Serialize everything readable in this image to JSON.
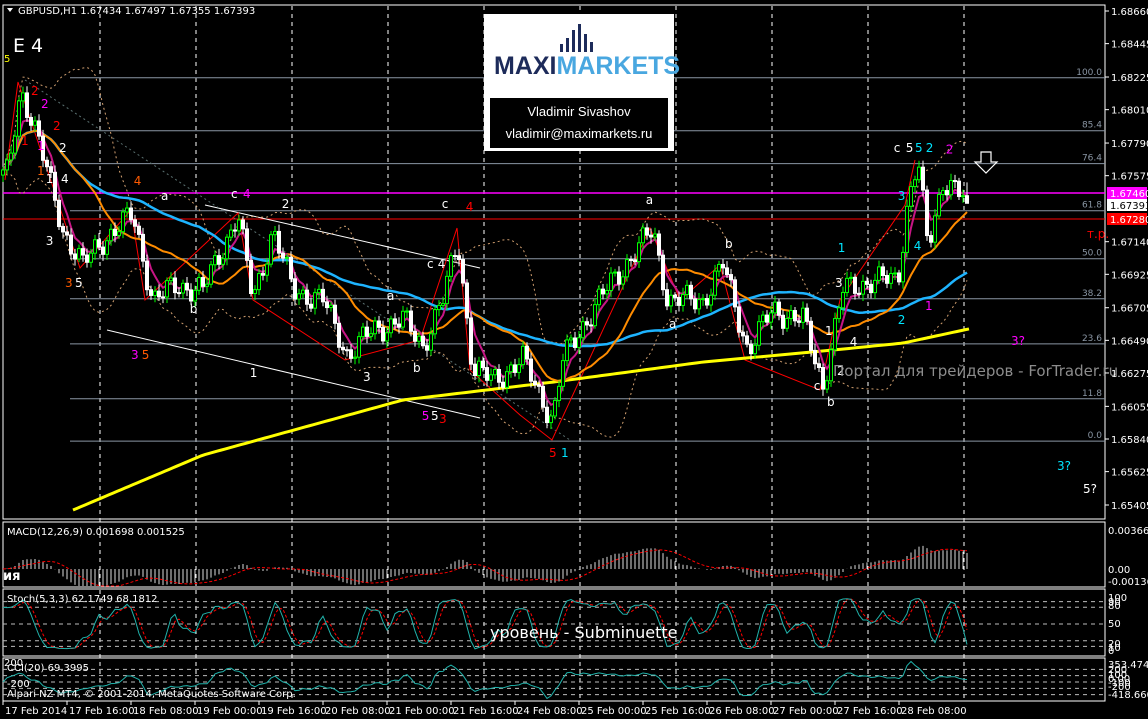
{
  "header": {
    "symbol_line": "GBPUSD,H1  1.67434 1.67497 1.67355 1.67393",
    "wave_title": "E 4",
    "corner_mark": "5"
  },
  "logo": {
    "brand_dark": "MAXI",
    "brand_light": "MARKETS",
    "author": "Vladimir Sivashov",
    "email": "vladimir@maximarkets.ru"
  },
  "watermark": "Портал для трейдеров - ForTrader.ru",
  "overlay_ru": "ия",
  "overlay_level": "уровень - Subminuette",
  "footer": "Alpari NZ MT4, © 2001-2014, MetaQuotes Software Corp.",
  "colors": {
    "bull": "#00ff00",
    "bear": "#ffffff",
    "ma_fast": "#c71585",
    "ma_mid": "#ff8c00",
    "ma_slow": "#1eb4ff",
    "ma_long": "#ffff00",
    "magenta_line": "#ff00ff",
    "red_line": "#ff0000",
    "grid": "#8a96a4"
  },
  "chart_data": {
    "type": "candlestick",
    "title": "GBPUSD,H1",
    "ylim": [
      1.653,
      1.687
    ],
    "price_ticks": [
      "1.68660",
      "1.68445",
      "1.68225",
      "1.68010",
      "1.67790",
      "1.67575",
      "1.67140",
      "1.66925",
      "1.66705",
      "1.66490",
      "1.66275",
      "1.66055",
      "1.65840",
      "1.65625",
      "1.65405"
    ],
    "time_labels": [
      "17 Feb 2014",
      "17 Feb 16:00",
      "18 Feb 08:00",
      "19 Feb 00:00",
      "19 Feb 16:00",
      "20 Feb 08:00",
      "21 Feb 00:00",
      "21 Feb 16:00",
      "24 Feb 08:00",
      "25 Feb 00:00",
      "25 Feb 16:00",
      "26 Feb 08:00",
      "27 Feb 00:00",
      "27 Feb 16:00",
      "28 Feb 08:00"
    ],
    "bars_per_label": 16,
    "close_path": [
      [
        1.25,
        1.67579
      ],
      [
        4.5,
        1.68139
      ],
      [
        7.5,
        1.67942
      ],
      [
        11.25,
        1.67579
      ],
      [
        15,
        1.67217
      ],
      [
        20,
        1.66986
      ],
      [
        25,
        1.67151
      ],
      [
        32.5,
        1.67316
      ],
      [
        37.5,
        1.66755
      ],
      [
        43.75,
        1.66854
      ],
      [
        50,
        1.66821
      ],
      [
        58.75,
        1.67316
      ],
      [
        62.5,
        1.66755
      ],
      [
        67.5,
        1.67217
      ],
      [
        72.5,
        1.66821
      ],
      [
        80,
        1.66755
      ],
      [
        86.25,
        1.66393
      ],
      [
        92.5,
        1.66558
      ],
      [
        100,
        1.66624
      ],
      [
        105,
        1.66459
      ],
      [
        110,
        1.66755
      ],
      [
        113.75,
        1.67151
      ],
      [
        117.5,
        1.66294
      ],
      [
        122.5,
        1.66228
      ],
      [
        130,
        1.6636
      ],
      [
        137.5,
        1.65965
      ],
      [
        140,
        1.6636
      ],
      [
        145,
        1.66591
      ],
      [
        152.5,
        1.66887
      ],
      [
        162.5,
        1.67217
      ],
      [
        166.25,
        1.66755
      ],
      [
        175,
        1.66755
      ],
      [
        180,
        1.66986
      ],
      [
        186.25,
        1.66426
      ],
      [
        192.5,
        1.6669
      ],
      [
        200,
        1.66624
      ],
      [
        205,
        1.66195
      ],
      [
        210,
        1.66821
      ],
      [
        217.5,
        1.66887
      ],
      [
        223.75,
        1.66887
      ],
      [
        226.25,
        1.67414
      ],
      [
        228.75,
        1.67678
      ],
      [
        231.25,
        1.67085
      ],
      [
        235,
        1.67546
      ],
      [
        237.5,
        1.67513
      ],
      [
        241,
        1.67393
      ]
    ],
    "long_ma_path": [
      [
        17.5,
        1.65372
      ],
      [
        50,
        1.65734
      ],
      [
        100,
        1.66097
      ],
      [
        137.5,
        1.66215
      ],
      [
        175,
        1.66347
      ],
      [
        207.5,
        1.66426
      ],
      [
        225,
        1.66472
      ],
      [
        242.5,
        1.66571
      ]
    ],
    "fib_levels": [
      {
        "label": "100.0",
        "price": 1.6822
      },
      {
        "label": "85.4",
        "price": 1.67871
      },
      {
        "label": "76.4",
        "price": 1.67654
      },
      {
        "label": "61.8",
        "price": 1.67344
      },
      {
        "label": "50.0",
        "price": 1.67028
      },
      {
        "label": "38.2",
        "price": 1.66764
      },
      {
        "label": "23.6",
        "price": 1.66467
      },
      {
        "label": "11.8",
        "price": 1.66105
      },
      {
        "label": "0.0",
        "price": 1.65826
      }
    ],
    "price_markers": [
      {
        "label": "1.67460",
        "price": 1.6746,
        "color": "#ff00ff"
      },
      {
        "label": "1.67393",
        "price": 1.67393,
        "color": "#ffffff"
      },
      {
        "label": "1.67280",
        "price": 1.6728,
        "color": "#ff0000"
      }
    ],
    "wave_labels": [
      {
        "t": "1",
        "c": "#ff0000",
        "bar": 4.5,
        "p": 1.67777
      },
      {
        "t": "2",
        "c": "#ff0000",
        "bar": 7,
        "p": 1.68106
      },
      {
        "t": "2",
        "c": "#ff00ff",
        "bar": 9.5,
        "p": 1.68021
      },
      {
        "t": "2",
        "c": "#ff0000",
        "bar": 12.5,
        "p": 1.67876
      },
      {
        "t": "1",
        "c": "#ff00ff",
        "bar": 8.5,
        "p": 1.67744
      },
      {
        "t": "2",
        "c": "#ffffff",
        "bar": 14,
        "p": 1.67731
      },
      {
        "t": "1",
        "c": "#ff5a00",
        "bar": 8.5,
        "p": 1.67579
      },
      {
        "t": "1",
        "c": "#ffffff",
        "bar": 10.7,
        "p": 1.67527
      },
      {
        "t": "4",
        "c": "#ffffff",
        "bar": 14.5,
        "p": 1.67527
      },
      {
        "t": "3",
        "c": "#ffffff",
        "bar": 10.7,
        "p": 1.67118
      },
      {
        "t": "3",
        "c": "#ff5a00",
        "bar": 15.5,
        "p": 1.66841
      },
      {
        "t": "5",
        "c": "#ffffff",
        "bar": 18,
        "p": 1.66841
      },
      {
        "t": "4",
        "c": "#ff5a00",
        "bar": 32.7,
        "p": 1.67513
      },
      {
        "t": "a",
        "c": "#ffffff",
        "bar": 39.5,
        "p": 1.67414
      },
      {
        "t": "3",
        "c": "#ff00ff",
        "bar": 32,
        "p": 1.66367
      },
      {
        "t": "5",
        "c": "#ff5a00",
        "bar": 34.7,
        "p": 1.66367
      },
      {
        "t": "b",
        "c": "#ffffff",
        "bar": 46.7,
        "p": 1.6667
      },
      {
        "t": "c",
        "c": "#ffffff",
        "bar": 57,
        "p": 1.67428
      },
      {
        "t": "4",
        "c": "#ff00ff",
        "bar": 60,
        "p": 1.67428
      },
      {
        "t": "2",
        "c": "#ffffff",
        "bar": 69.7,
        "p": 1.67362
      },
      {
        "t": "1",
        "c": "#ffffff",
        "bar": 61.7,
        "p": 1.66248
      },
      {
        "t": "3",
        "c": "#ffffff",
        "bar": 90,
        "p": 1.66222
      },
      {
        "t": "a",
        "c": "#ffffff",
        "bar": 96,
        "p": 1.66755
      },
      {
        "t": "b",
        "c": "#ffffff",
        "bar": 102.5,
        "p": 1.66281
      },
      {
        "t": "c",
        "c": "#ffffff",
        "bar": 106,
        "p": 1.66966
      },
      {
        "t": "4",
        "c": "#ffffff",
        "bar": 108.7,
        "p": 1.66966
      },
      {
        "t": "c",
        "c": "#ffffff",
        "bar": 109.7,
        "p": 1.67362
      },
      {
        "t": "4",
        "c": "#ff0000",
        "bar": 115.7,
        "p": 1.67342
      },
      {
        "t": "5",
        "c": "#ff00ff",
        "bar": 104.7,
        "p": 1.65965
      },
      {
        "t": "5",
        "c": "#ffffff",
        "bar": 107,
        "p": 1.65965
      },
      {
        "t": "3",
        "c": "#ff0000",
        "bar": 109,
        "p": 1.65945
      },
      {
        "t": "5",
        "c": "#ff0000",
        "bar": 136.5,
        "p": 1.65721
      },
      {
        "t": "1",
        "c": "#00e5ff",
        "bar": 139.5,
        "p": 1.65721
      },
      {
        "t": "a",
        "c": "#ffffff",
        "bar": 160.7,
        "p": 1.67388
      },
      {
        "t": "a",
        "c": "#ffffff",
        "bar": 166.5,
        "p": 1.66571
      },
      {
        "t": "b",
        "c": "#ffffff",
        "bar": 180.5,
        "p": 1.67098
      },
      {
        "t": "c",
        "c": "#ffffff",
        "bar": 202.7,
        "p": 1.66162
      },
      {
        "t": "b",
        "c": "#ffffff",
        "bar": 206,
        "p": 1.66057
      },
      {
        "t": "1",
        "c": "#ffffff",
        "bar": 205.5,
        "p": 1.66525
      },
      {
        "t": "2",
        "c": "#ffffff",
        "bar": 208.5,
        "p": 1.66261
      },
      {
        "t": "4",
        "c": "#ffffff",
        "bar": 211.7,
        "p": 1.66452
      },
      {
        "t": "3",
        "c": "#ffffff",
        "bar": 208,
        "p": 1.66841
      },
      {
        "t": "1",
        "c": "#00e5ff",
        "bar": 208.7,
        "p": 1.67072
      },
      {
        "t": "2",
        "c": "#00e5ff",
        "bar": 223.7,
        "p": 1.66597
      },
      {
        "t": "1",
        "c": "#ff00ff",
        "bar": 230.5,
        "p": 1.6669
      },
      {
        "t": "4",
        "c": "#00e5ff",
        "bar": 227.7,
        "p": 1.67085
      },
      {
        "t": "3",
        "c": "#00e5ff",
        "bar": 223.7,
        "p": 1.67414
      },
      {
        "t": "c",
        "c": "#ffffff",
        "bar": 222.7,
        "p": 1.67731
      },
      {
        "t": "5",
        "c": "#ffffff",
        "bar": 225.7,
        "p": 1.67731
      },
      {
        "t": "5",
        "c": "#00e5ff",
        "bar": 228,
        "p": 1.67731
      },
      {
        "t": "2",
        "c": "#00e5ff",
        "bar": 230.7,
        "p": 1.67731
      },
      {
        "t": "2",
        "c": "#ff00ff",
        "bar": 235.7,
        "p": 1.6772
      },
      {
        "t": "3?",
        "c": "#ff00ff",
        "bar": 252,
        "p": 1.66459
      },
      {
        "t": "3?",
        "c": "#00e5ff",
        "bar": 263.5,
        "p": 1.65635
      },
      {
        "t": "5?",
        "c": "#ffffff",
        "bar": 270,
        "p": 1.65484,
        "big": true
      },
      {
        "t": "т.р.",
        "c": "#ff0000",
        "bar": 271,
        "p": 1.67164
      }
    ],
    "macd": {
      "header": "MACD(12,26,9) 0.001698 0.001525",
      "ticks": [
        "0.003661",
        "0.00",
        "-0.001362"
      ]
    },
    "stoch": {
      "header": "Stoch(5,3,3) 62.1749 68.1812",
      "ticks": [
        "100",
        "90",
        "80",
        "50",
        "20",
        "10",
        "0"
      ],
      "levels": [
        90,
        80,
        50,
        20,
        10
      ]
    },
    "cci": {
      "header": "CCI(20) 69.3995",
      "ticks": [
        "353.4747",
        "200",
        "100",
        "0.00",
        "-100",
        "-200",
        "-418.6608"
      ],
      "level_label_top": "200",
      "level_label_bottom": "-200"
    }
  }
}
